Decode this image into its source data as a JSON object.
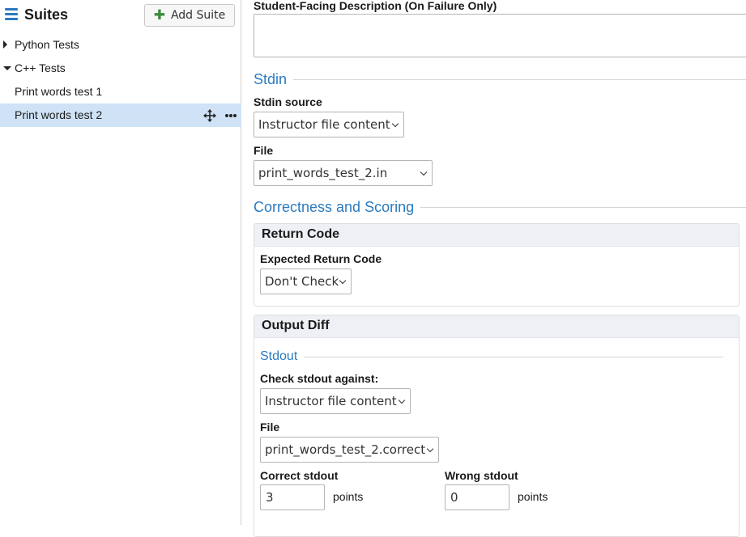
{
  "sidebar": {
    "title": "Suites",
    "add_suite_label": "Add Suite",
    "tree": [
      {
        "label": "Python Tests",
        "expanded": false
      },
      {
        "label": "C++ Tests",
        "expanded": true
      },
      {
        "label": "Print words test 1"
      },
      {
        "label": "Print words test 2",
        "selected": true
      }
    ]
  },
  "main": {
    "description_label": "Student-Facing Description (On Failure Only)",
    "description_value": "",
    "stdin_section": "Stdin",
    "stdin_source_label": "Stdin source",
    "stdin_source_value": "Instructor file content",
    "stdin_file_label": "File",
    "stdin_file_value": "print_words_test_2.in",
    "scoring_section": "Correctness and Scoring",
    "return_code": {
      "title": "Return Code",
      "expected_label": "Expected Return Code",
      "expected_value": "Don't Check"
    },
    "output_diff": {
      "title": "Output Diff",
      "stdout_section": "Stdout",
      "check_label": "Check stdout against:",
      "check_value": "Instructor file content",
      "file_label": "File",
      "file_value": "print_words_test_2.correct",
      "correct_label": "Correct stdout",
      "correct_value": "3",
      "wrong_label": "Wrong stdout",
      "wrong_value": "0",
      "points_label": "points"
    }
  },
  "colors": {
    "accent": "#2b7bbf",
    "selected_row": "#cfe2f6",
    "add_icon": "#3c8a3c"
  }
}
